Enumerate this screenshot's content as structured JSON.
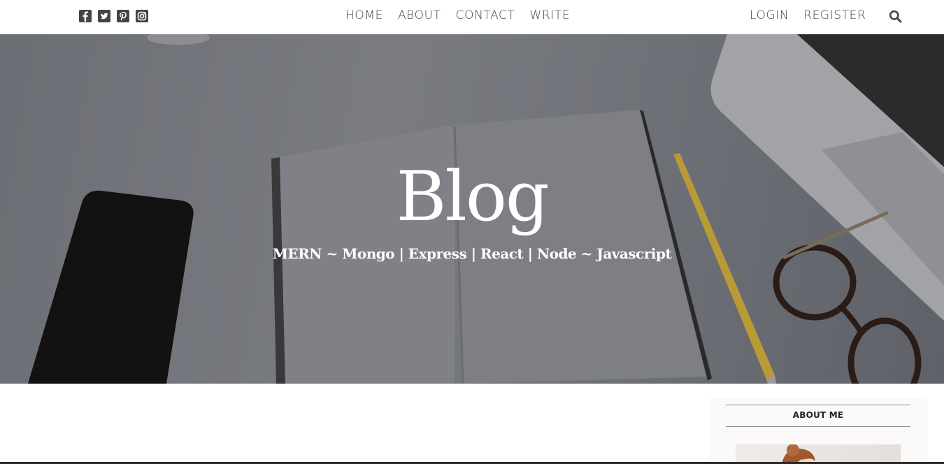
{
  "social_icons": [
    "facebook-icon",
    "twitter-icon",
    "pinterest-icon",
    "instagram-icon"
  ],
  "nav": {
    "center": [
      {
        "label": "HOME"
      },
      {
        "label": "ABOUT"
      },
      {
        "label": "CONTACT"
      },
      {
        "label": "WRITE"
      }
    ],
    "right": [
      {
        "label": "LOGIN"
      },
      {
        "label": "REGISTER"
      }
    ],
    "search_icon": "search-icon"
  },
  "hero": {
    "title": "Blog",
    "subtitle": "MERN ~ Mongo | Express | React | Node ~ Javascript"
  },
  "sidebar": {
    "title": "ABOUT ME"
  },
  "colors": {
    "nav_text": "#444444",
    "hero_text": "#ffffff",
    "sidebar_bg": "#fbf9f9"
  }
}
